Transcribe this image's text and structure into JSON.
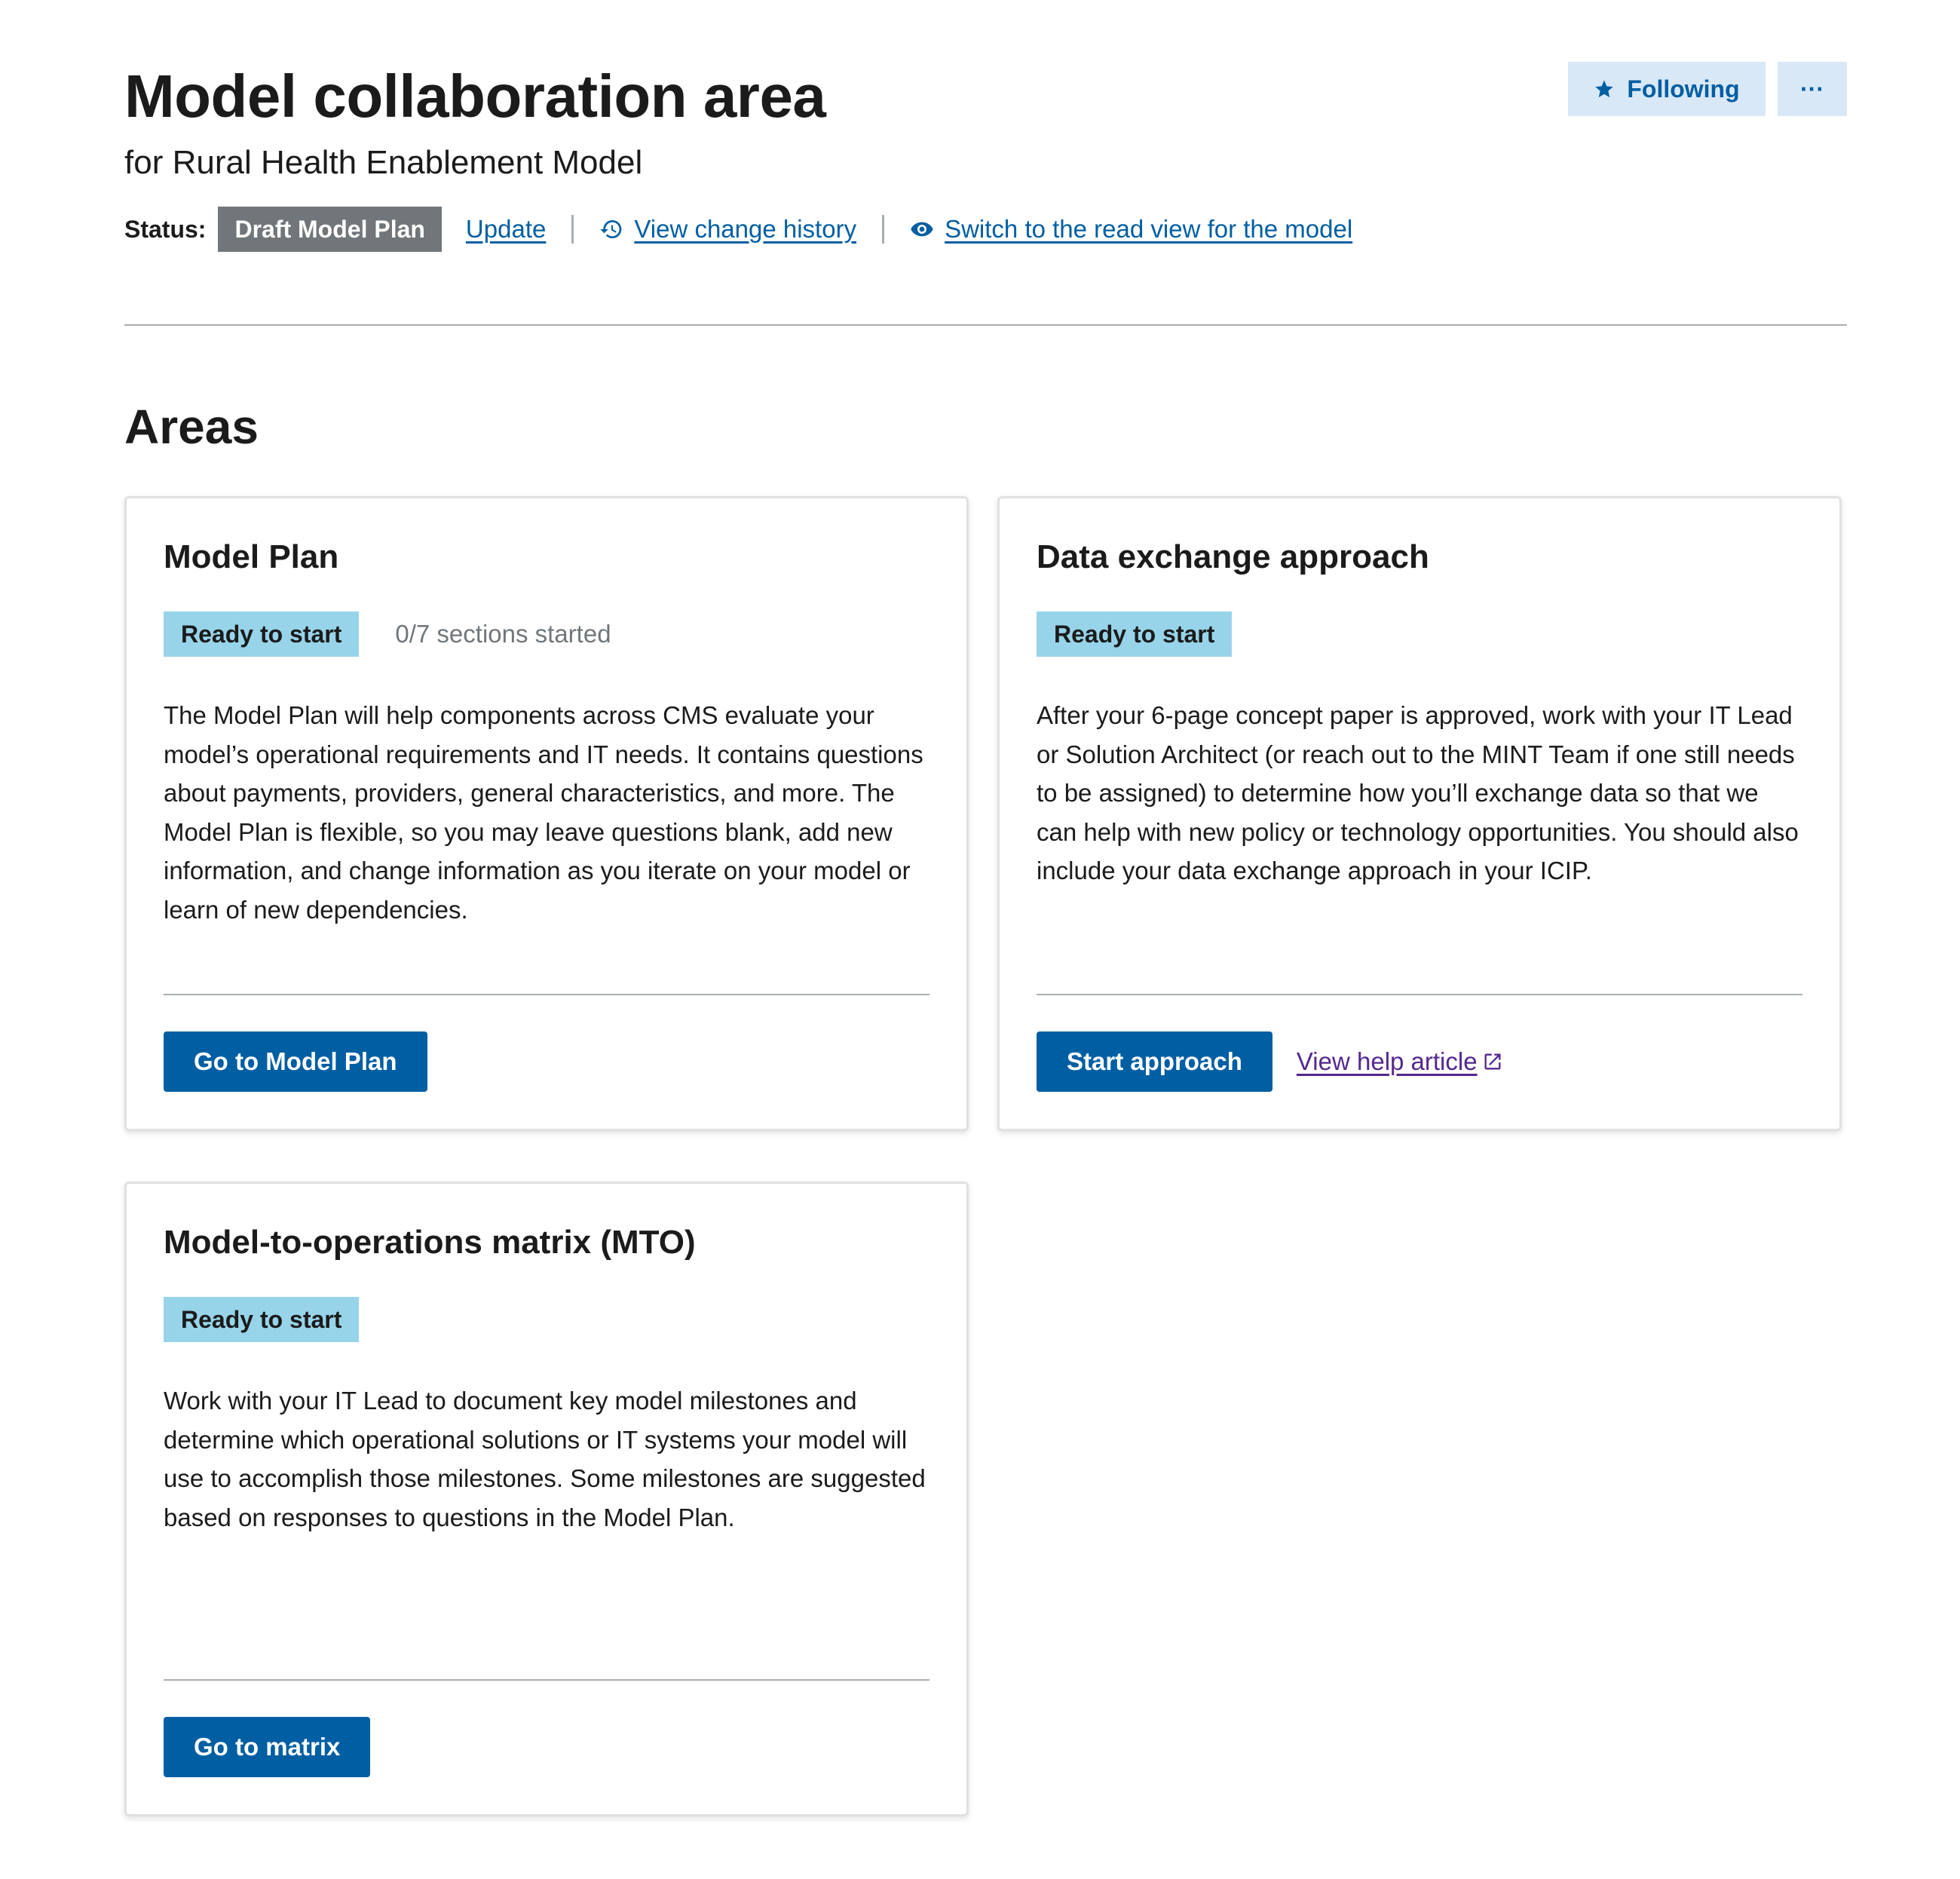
{
  "header": {
    "title": "Model collaboration area",
    "subtitle": "for Rural Health Enablement Model",
    "status_label": "Status:",
    "status_value": "Draft Model Plan",
    "update_link": "Update",
    "history_link": "View change history",
    "read_view_link": "Switch to the read view for the model",
    "following_label": "Following",
    "more_label": "···"
  },
  "areas": {
    "title": "Areas",
    "cards": [
      {
        "title": "Model Plan",
        "tag": "Ready to start",
        "note": "0/7 sections started",
        "body": "The Model Plan will help components across CMS evaluate your model’s operational requirements and IT needs. It contains questions about payments, providers, general characteristics, and more. The Model Plan is flexible, so you may leave questions blank, add new information, and change information as you iterate on your model or learn of new dependencies.",
        "button": "Go to Model Plan"
      },
      {
        "title": "Data exchange approach",
        "tag": "Ready to start",
        "body": "After your 6-page concept paper is approved, work with your IT Lead or Solution Architect (or reach out to the MINT Team if one still needs to be assigned) to determine how you’ll exchange data so that we can help with new policy or technology opportunities. You should also include your data exchange approach in your ICIP.",
        "button": "Start approach",
        "help_link": "View help article"
      },
      {
        "title": "Model-to-operations matrix (MTO)",
        "tag": "Ready to start",
        "body": "Work with your IT Lead to document key model milestones and determine which operational solutions or IT systems your model will use to accomplish those milestones. Some milestones are suggested based on responses to questions in the Model Plan.",
        "button": "Go to matrix"
      }
    ]
  },
  "colors": {
    "primary": "#005ea2",
    "tag_bg": "#97d4ea",
    "status_badge_bg": "#71767a",
    "following_bg": "#d9e8f6",
    "visited_link": "#54278f"
  },
  "icons": {
    "following": "star-icon",
    "history": "history-icon",
    "read_view": "eye-icon",
    "help_link": "external-link-icon"
  }
}
